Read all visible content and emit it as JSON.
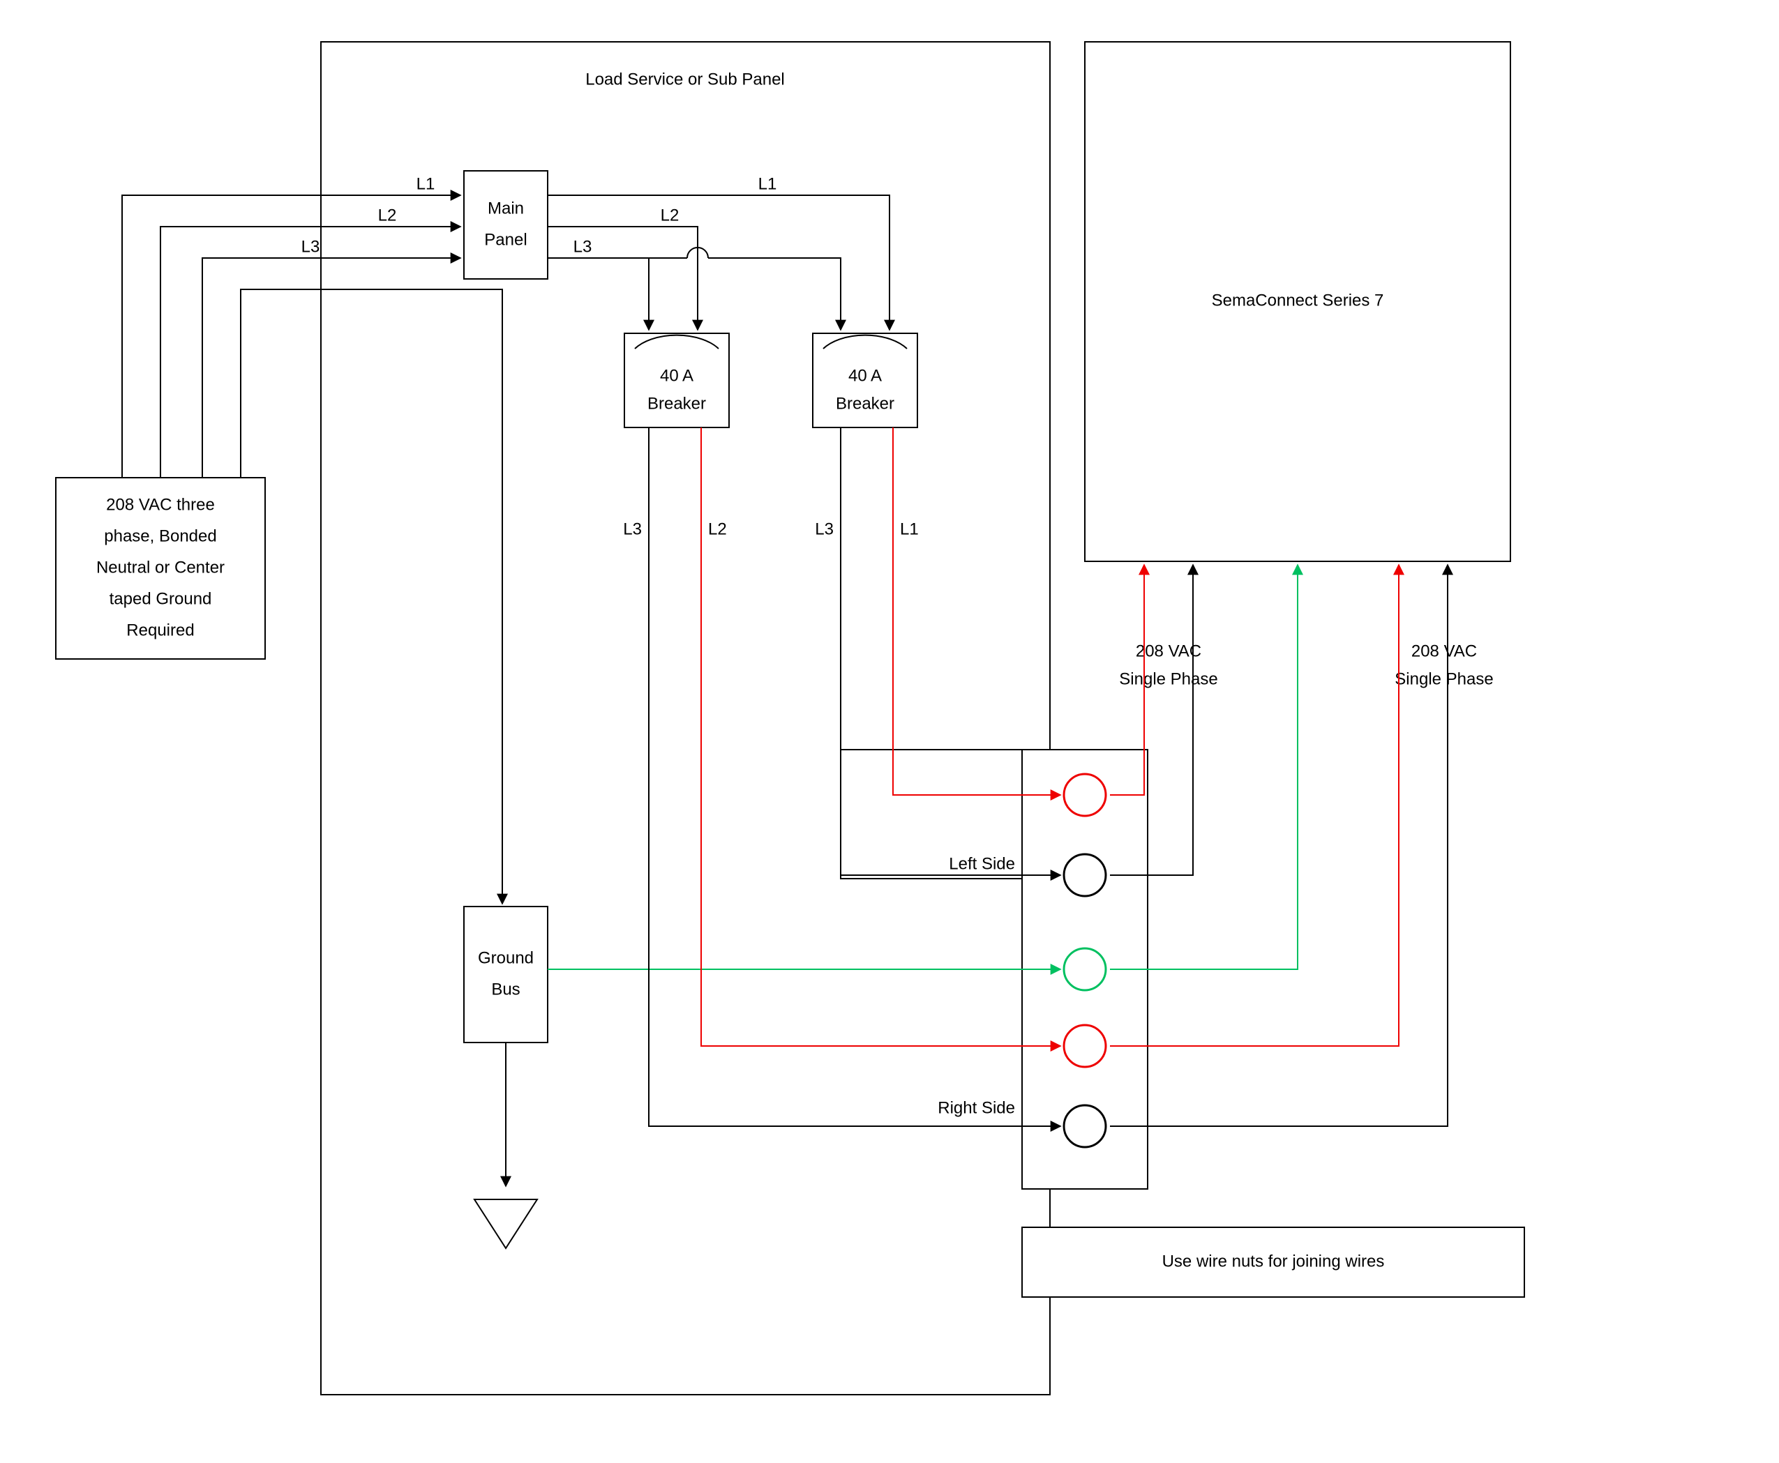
{
  "panel": {
    "title": "Load Service or Sub Panel",
    "main_panel": "Main Panel",
    "main_panel_line1": "Main",
    "main_panel_line2": "Panel",
    "breaker_amp": "40 A",
    "breaker_label": "Breaker",
    "ground_bus": "Ground Bus",
    "ground_bus_line1": "Ground",
    "ground_bus_line2": "Bus",
    "left_side": "Left Side",
    "right_side": "Right Side"
  },
  "source": {
    "line1": "208 VAC three",
    "line2": "phase, Bonded",
    "line3": "Neutral or Center",
    "line4": "taped Ground",
    "line5": "Required"
  },
  "device": {
    "title": "SemaConnect Series 7",
    "phase_label_line1": "208 VAC",
    "phase_label_line2": "Single Phase",
    "wire_nuts": "Use wire nuts for joining wires"
  },
  "phases": {
    "L1": "L1",
    "L2": "L2",
    "L3": "L3"
  },
  "colors": {
    "black": "#000000",
    "red": "#ee0000",
    "green": "#00c060"
  }
}
